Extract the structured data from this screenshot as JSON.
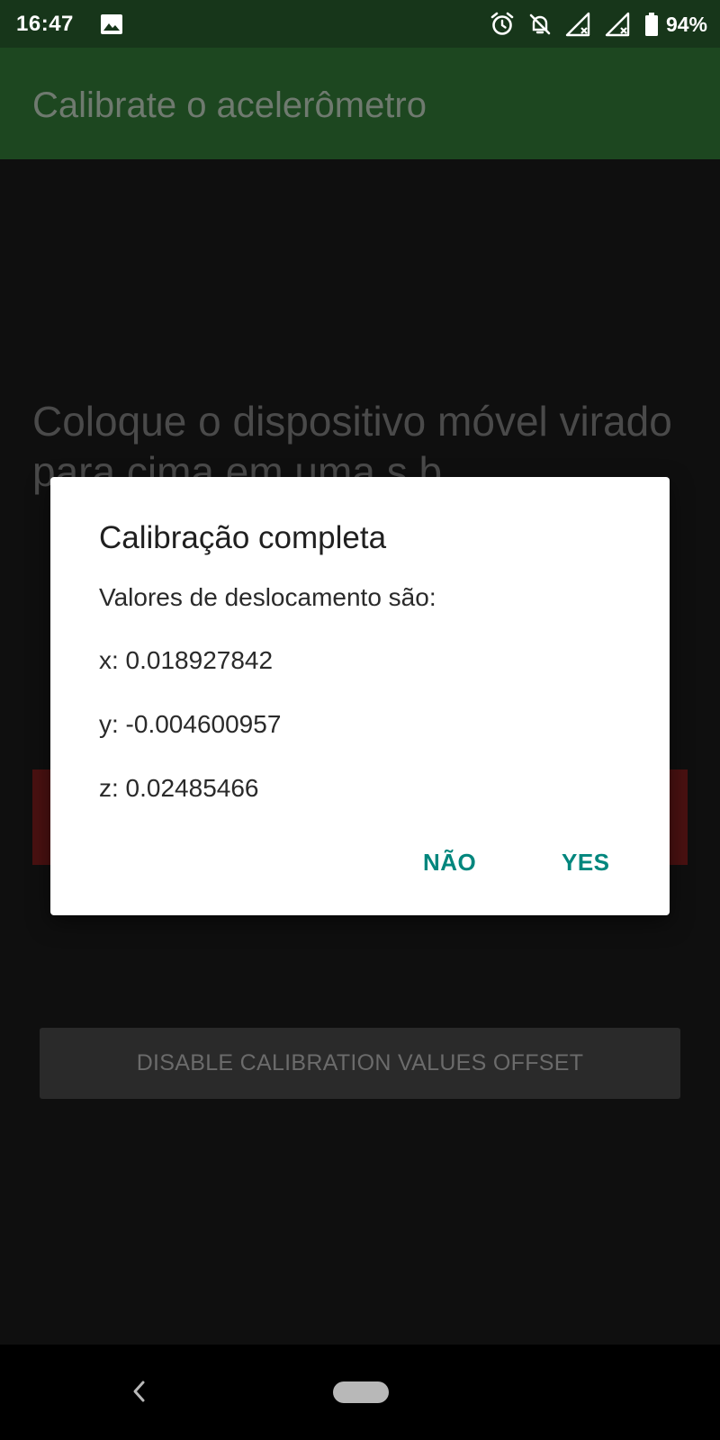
{
  "status_bar": {
    "time": "16:47",
    "battery": "94%",
    "icons": [
      "gallery-icon",
      "alarm-icon",
      "notifications-off-icon",
      "signal-x-icon",
      "signal-x-icon",
      "battery-icon"
    ]
  },
  "app_bar": {
    "title": "Calibrate o acelerômetro"
  },
  "main": {
    "instruction": "Coloque o dispositivo móvel virado para cima em uma s b",
    "disable_offset_label": "DISABLE CALIBRATION VALUES OFFSET"
  },
  "dialog": {
    "title": "Calibração completa",
    "intro": "Valores de deslocamento são:",
    "x": "x: 0.018927842",
    "y": "y: -0.004600957",
    "z": "z: 0.02485466",
    "no_label": "NÃO",
    "yes_label": "YES"
  },
  "colors": {
    "status_bar": "#17361a",
    "app_bar": "#1d4720",
    "accent": "#00867d",
    "background": "#0f0f0f"
  }
}
